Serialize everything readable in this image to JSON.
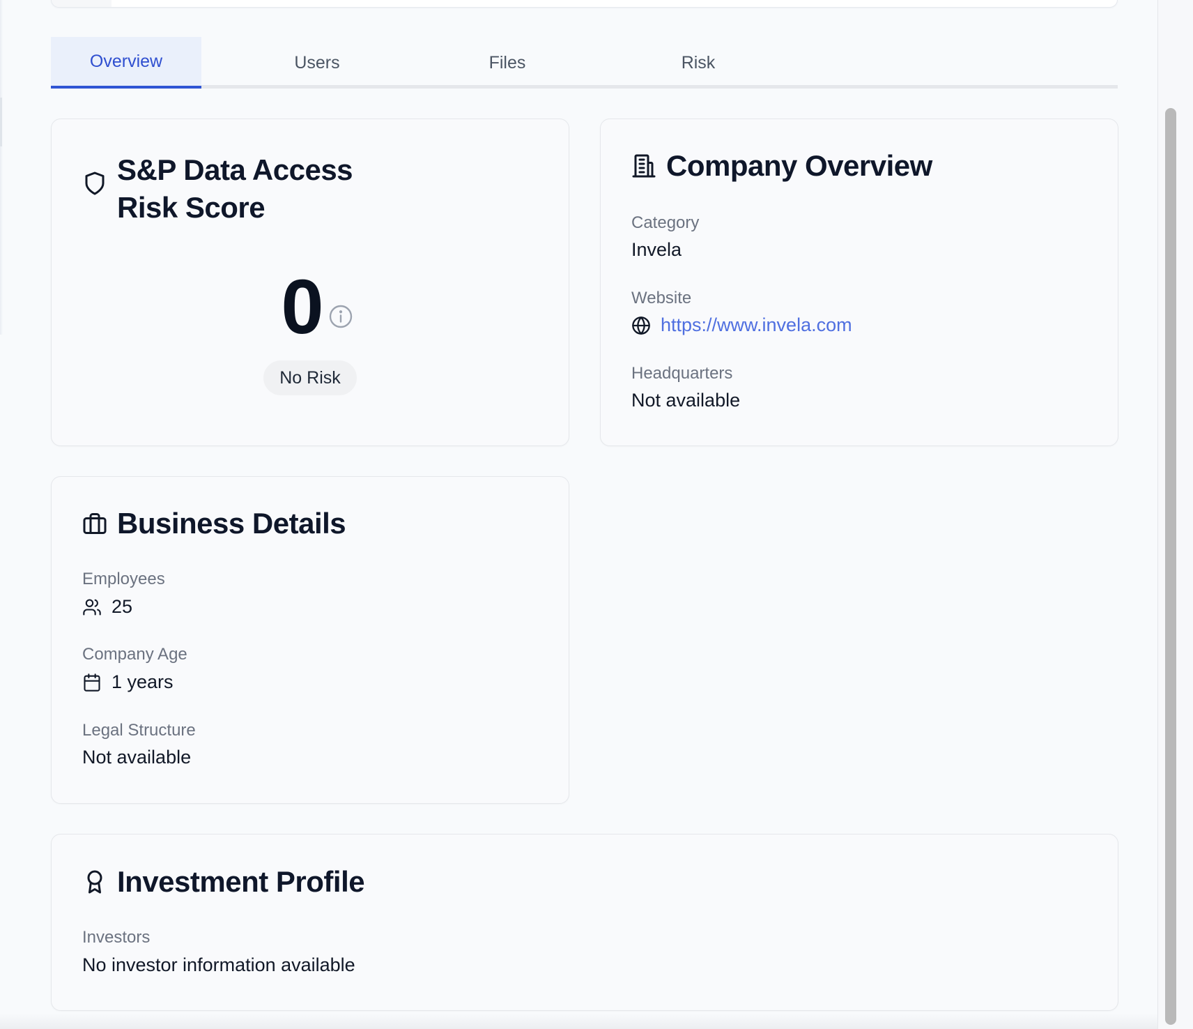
{
  "tabs": [
    {
      "label": "Overview",
      "active": true
    },
    {
      "label": "Users",
      "active": false
    },
    {
      "label": "Files",
      "active": false
    },
    {
      "label": "Risk",
      "active": false
    }
  ],
  "risk_card": {
    "title": "S&P Data Access Risk Score",
    "icon": "shield-icon",
    "score": "0",
    "badge": "No Risk",
    "info_icon": "info-icon"
  },
  "company_card": {
    "title": "Company Overview",
    "icon": "building-icon",
    "category_label": "Category",
    "category_value": "Invela",
    "website_label": "Website",
    "website_value": "https://www.invela.com",
    "website_icon": "globe-icon",
    "hq_label": "Headquarters",
    "hq_value": "Not available"
  },
  "business_card": {
    "title": "Business Details",
    "icon": "briefcase-icon",
    "employees_label": "Employees",
    "employees_value": "25",
    "employees_icon": "users-icon",
    "age_label": "Company Age",
    "age_value": "1 years",
    "age_icon": "calendar-icon",
    "legal_label": "Legal Structure",
    "legal_value": "Not available"
  },
  "investment_card": {
    "title": "Investment Profile",
    "icon": "award-icon",
    "investors_label": "Investors",
    "investors_value": "No investor information available"
  },
  "colors": {
    "accent": "#2f55d4",
    "link": "#4f6fe0",
    "muted": "#6b7280",
    "background": "#f8fafc"
  }
}
